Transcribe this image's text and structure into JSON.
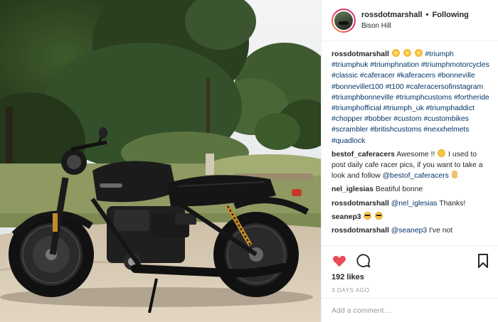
{
  "header": {
    "username": "rossdotmarshall",
    "separator": "•",
    "follow_label": "Following",
    "location": "Bison Hill"
  },
  "photo": {
    "alt_subject": "black motorcycle parked on a dirt path beside trees",
    "sky_color": "#eef0f2",
    "accent_colors": {
      "bike": "#161616",
      "foliage": "#2f4424",
      "grass": "#8e9a62",
      "path": "#d9ccb7"
    }
  },
  "caption": {
    "username": "rossdotmarshall",
    "emojis": [
      "sun-emoji",
      "sun-emoji",
      "sun-emoji"
    ],
    "hashtags": [
      "#triumph",
      "#triumphuk",
      "#triumphnation",
      "#triumphmotorcycles",
      "#classic",
      "#caferacer",
      "#kaferacers",
      "#bonneville",
      "#bonnevillet100",
      "#t100",
      "#caferacersofinstagram",
      "#triumphbonneville",
      "#triumphcustoms",
      "#fortheride",
      "#triumphofficial",
      "#triumph_uk",
      "#triumphaddict",
      "#chopper",
      "#bobber",
      "#custom",
      "#custombikes",
      "#scrambler",
      "#britishcustoms",
      "#nexxhelmets",
      "#quadlock"
    ]
  },
  "comments": [
    {
      "username": "bestof_caferacers",
      "text_before": "Awesome !! ",
      "text_after": " I used to post daily cafe racer pics, if you want to take a look and follow ",
      "mention": "@bestof_caferacers"
    },
    {
      "username": "nel_iglesias",
      "text": "Beatiful bonne"
    },
    {
      "username": "rossdotmarshall",
      "mention": "@nel_iglesias",
      "text": " Thanks!"
    },
    {
      "username": "seanep3",
      "text": ""
    },
    {
      "username": "rossdotmarshall",
      "mention": "@seanep3",
      "text": " I've not"
    }
  ],
  "actions": {
    "like_icon": "heart-icon",
    "comment_icon": "comment-icon",
    "save_icon": "bookmark-icon",
    "like_color": "#ed4956",
    "likes_label": "192 likes",
    "time_ago": "3 DAYS AGO"
  },
  "add_comment": {
    "placeholder": "Add a comment…"
  }
}
